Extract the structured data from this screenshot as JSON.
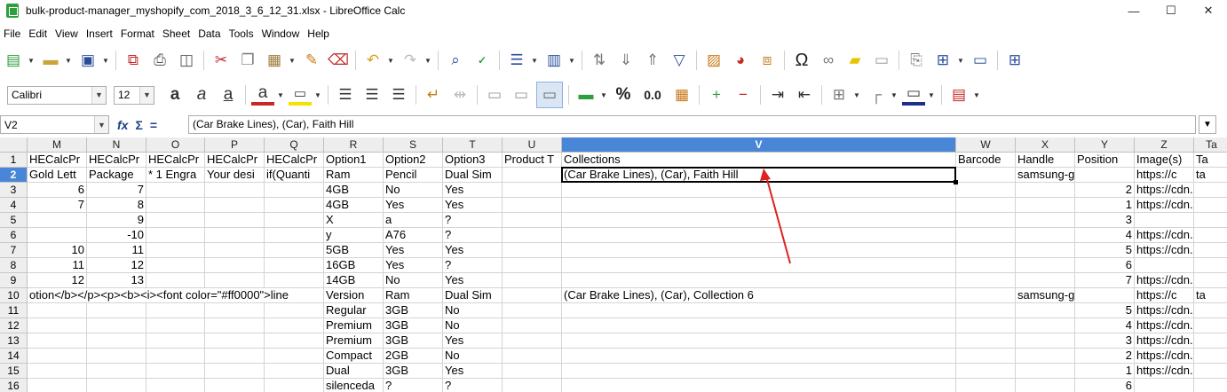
{
  "window": {
    "title": "bulk-product-manager_myshopify_com_2018_3_6_12_31.xlsx - LibreOffice Calc",
    "minimize": "—",
    "maximize": "☐",
    "close": "✕"
  },
  "menubar": [
    "File",
    "Edit",
    "View",
    "Insert",
    "Format",
    "Sheet",
    "Data",
    "Tools",
    "Window",
    "Help"
  ],
  "toolbar": {
    "font_name": "Calibri",
    "font_size": "12",
    "percent": "%",
    "decimal": "0.0"
  },
  "formula_bar": {
    "cell_ref": "V2",
    "content": "(Car Brake Lines), (Car), Faith Hill"
  },
  "columns": [
    {
      "id": "M",
      "label": "M"
    },
    {
      "id": "N",
      "label": "N"
    },
    {
      "id": "O",
      "label": "O"
    },
    {
      "id": "P",
      "label": "P"
    },
    {
      "id": "Q",
      "label": "Q"
    },
    {
      "id": "R",
      "label": "R"
    },
    {
      "id": "S",
      "label": "S"
    },
    {
      "id": "T",
      "label": "T"
    },
    {
      "id": "U",
      "label": "U"
    },
    {
      "id": "V",
      "label": "V"
    },
    {
      "id": "W",
      "label": "W"
    },
    {
      "id": "X",
      "label": "X"
    },
    {
      "id": "Y",
      "label": "Y"
    },
    {
      "id": "Z",
      "label": "Z"
    },
    {
      "id": "AA",
      "label": "Ta"
    }
  ],
  "rows": [
    {
      "n": "1",
      "cells": {
        "M": "HECalcPr",
        "N": "HECalcPr",
        "O": "HECalcPr",
        "P": "HECalcPr",
        "Q": "HECalcPr",
        "R": "Option1",
        "S": "Option2",
        "T": "Option3",
        "U": "Product T",
        "V": "Collections",
        "W": "Barcode",
        "X": "Handle",
        "Y": "Position",
        "Z": "Image(s)",
        "AA": "Ta"
      }
    },
    {
      "n": "2",
      "cells": {
        "M": "Gold Lett",
        "N": "Package",
        "O": "* 1 Engra",
        "P": "Your desi",
        "Q": "if(Quanti",
        "R": "Ram",
        "S": "Pencil",
        "T": "Dual Sim",
        "V": "(Car Brake Lines), (Car), Faith Hill",
        "X": "samsung-galaxy-no",
        "Z": "https://c",
        "AA": "ta"
      }
    },
    {
      "n": "3",
      "cells": {
        "M": "6",
        "N": "7",
        "R": "4GB",
        "S": "No",
        "T": "Yes",
        "Y": "2",
        "Z": "https://cdn.s"
      }
    },
    {
      "n": "4",
      "cells": {
        "M": "7",
        "N": "8",
        "R": "4GB",
        "S": "Yes",
        "T": "Yes",
        "Y": "1",
        "Z": "https://cdn.s"
      }
    },
    {
      "n": "5",
      "cells": {
        "N": "9",
        "R": "X",
        "S": "a",
        "T": "?",
        "Y": "3"
      }
    },
    {
      "n": "6",
      "cells": {
        "N": "-10",
        "R": "y",
        "S": "A76",
        "T": "?",
        "Y": "4",
        "Z": "https://cdn.s"
      }
    },
    {
      "n": "7",
      "cells": {
        "M": "10",
        "N": "11",
        "R": "5GB",
        "S": "Yes",
        "T": "Yes",
        "Y": "5",
        "Z": "https://cdn.s"
      }
    },
    {
      "n": "8",
      "cells": {
        "M": "11",
        "N": "12",
        "R": "16GB",
        "S": "Yes",
        "T": "?",
        "Y": "6"
      }
    },
    {
      "n": "9",
      "cells": {
        "M": "12",
        "N": "13",
        "R": "14GB",
        "S": "No",
        "T": "Yes",
        "Y": "7",
        "Z": "https://cdn.s"
      }
    },
    {
      "n": "10",
      "cells": {
        "M": "otion</b></p><p><b><i><font color=\"#ff0000\">line",
        "R": "Version",
        "S": "Ram",
        "T": "Dual Sim",
        "V": "(Car Brake Lines), (Car), Collection 6",
        "X": "samsung-galaxy-no",
        "Z": "https://c",
        "AA": "ta"
      }
    },
    {
      "n": "11",
      "cells": {
        "R": "Regular",
        "S": "3GB",
        "T": "No",
        "Y": "5",
        "Z": "https://cdn.s"
      }
    },
    {
      "n": "12",
      "cells": {
        "R": "Premium",
        "S": "3GB",
        "T": "No",
        "Y": "4",
        "Z": "https://cdn.s"
      }
    },
    {
      "n": "13",
      "cells": {
        "R": "Premium",
        "S": "3GB",
        "T": "Yes",
        "Y": "3",
        "Z": "https://cdn.s"
      }
    },
    {
      "n": "14",
      "cells": {
        "R": "Compact",
        "S": "2GB",
        "T": "No",
        "Y": "2",
        "Z": "https://cdn.s"
      }
    },
    {
      "n": "15",
      "cells": {
        "R": "Dual",
        "S": "3GB",
        "T": "Yes",
        "Y": "1",
        "Z": "https://cdn.s"
      }
    },
    {
      "n": "16",
      "cells": {
        "R": "silenceda",
        "S": "?",
        "T": "?",
        "Y": "6"
      }
    }
  ],
  "selection": {
    "cell": "V2",
    "column": "V",
    "row": "2"
  },
  "accent_color": "#4a86d8",
  "annotation_color": "#e02020"
}
